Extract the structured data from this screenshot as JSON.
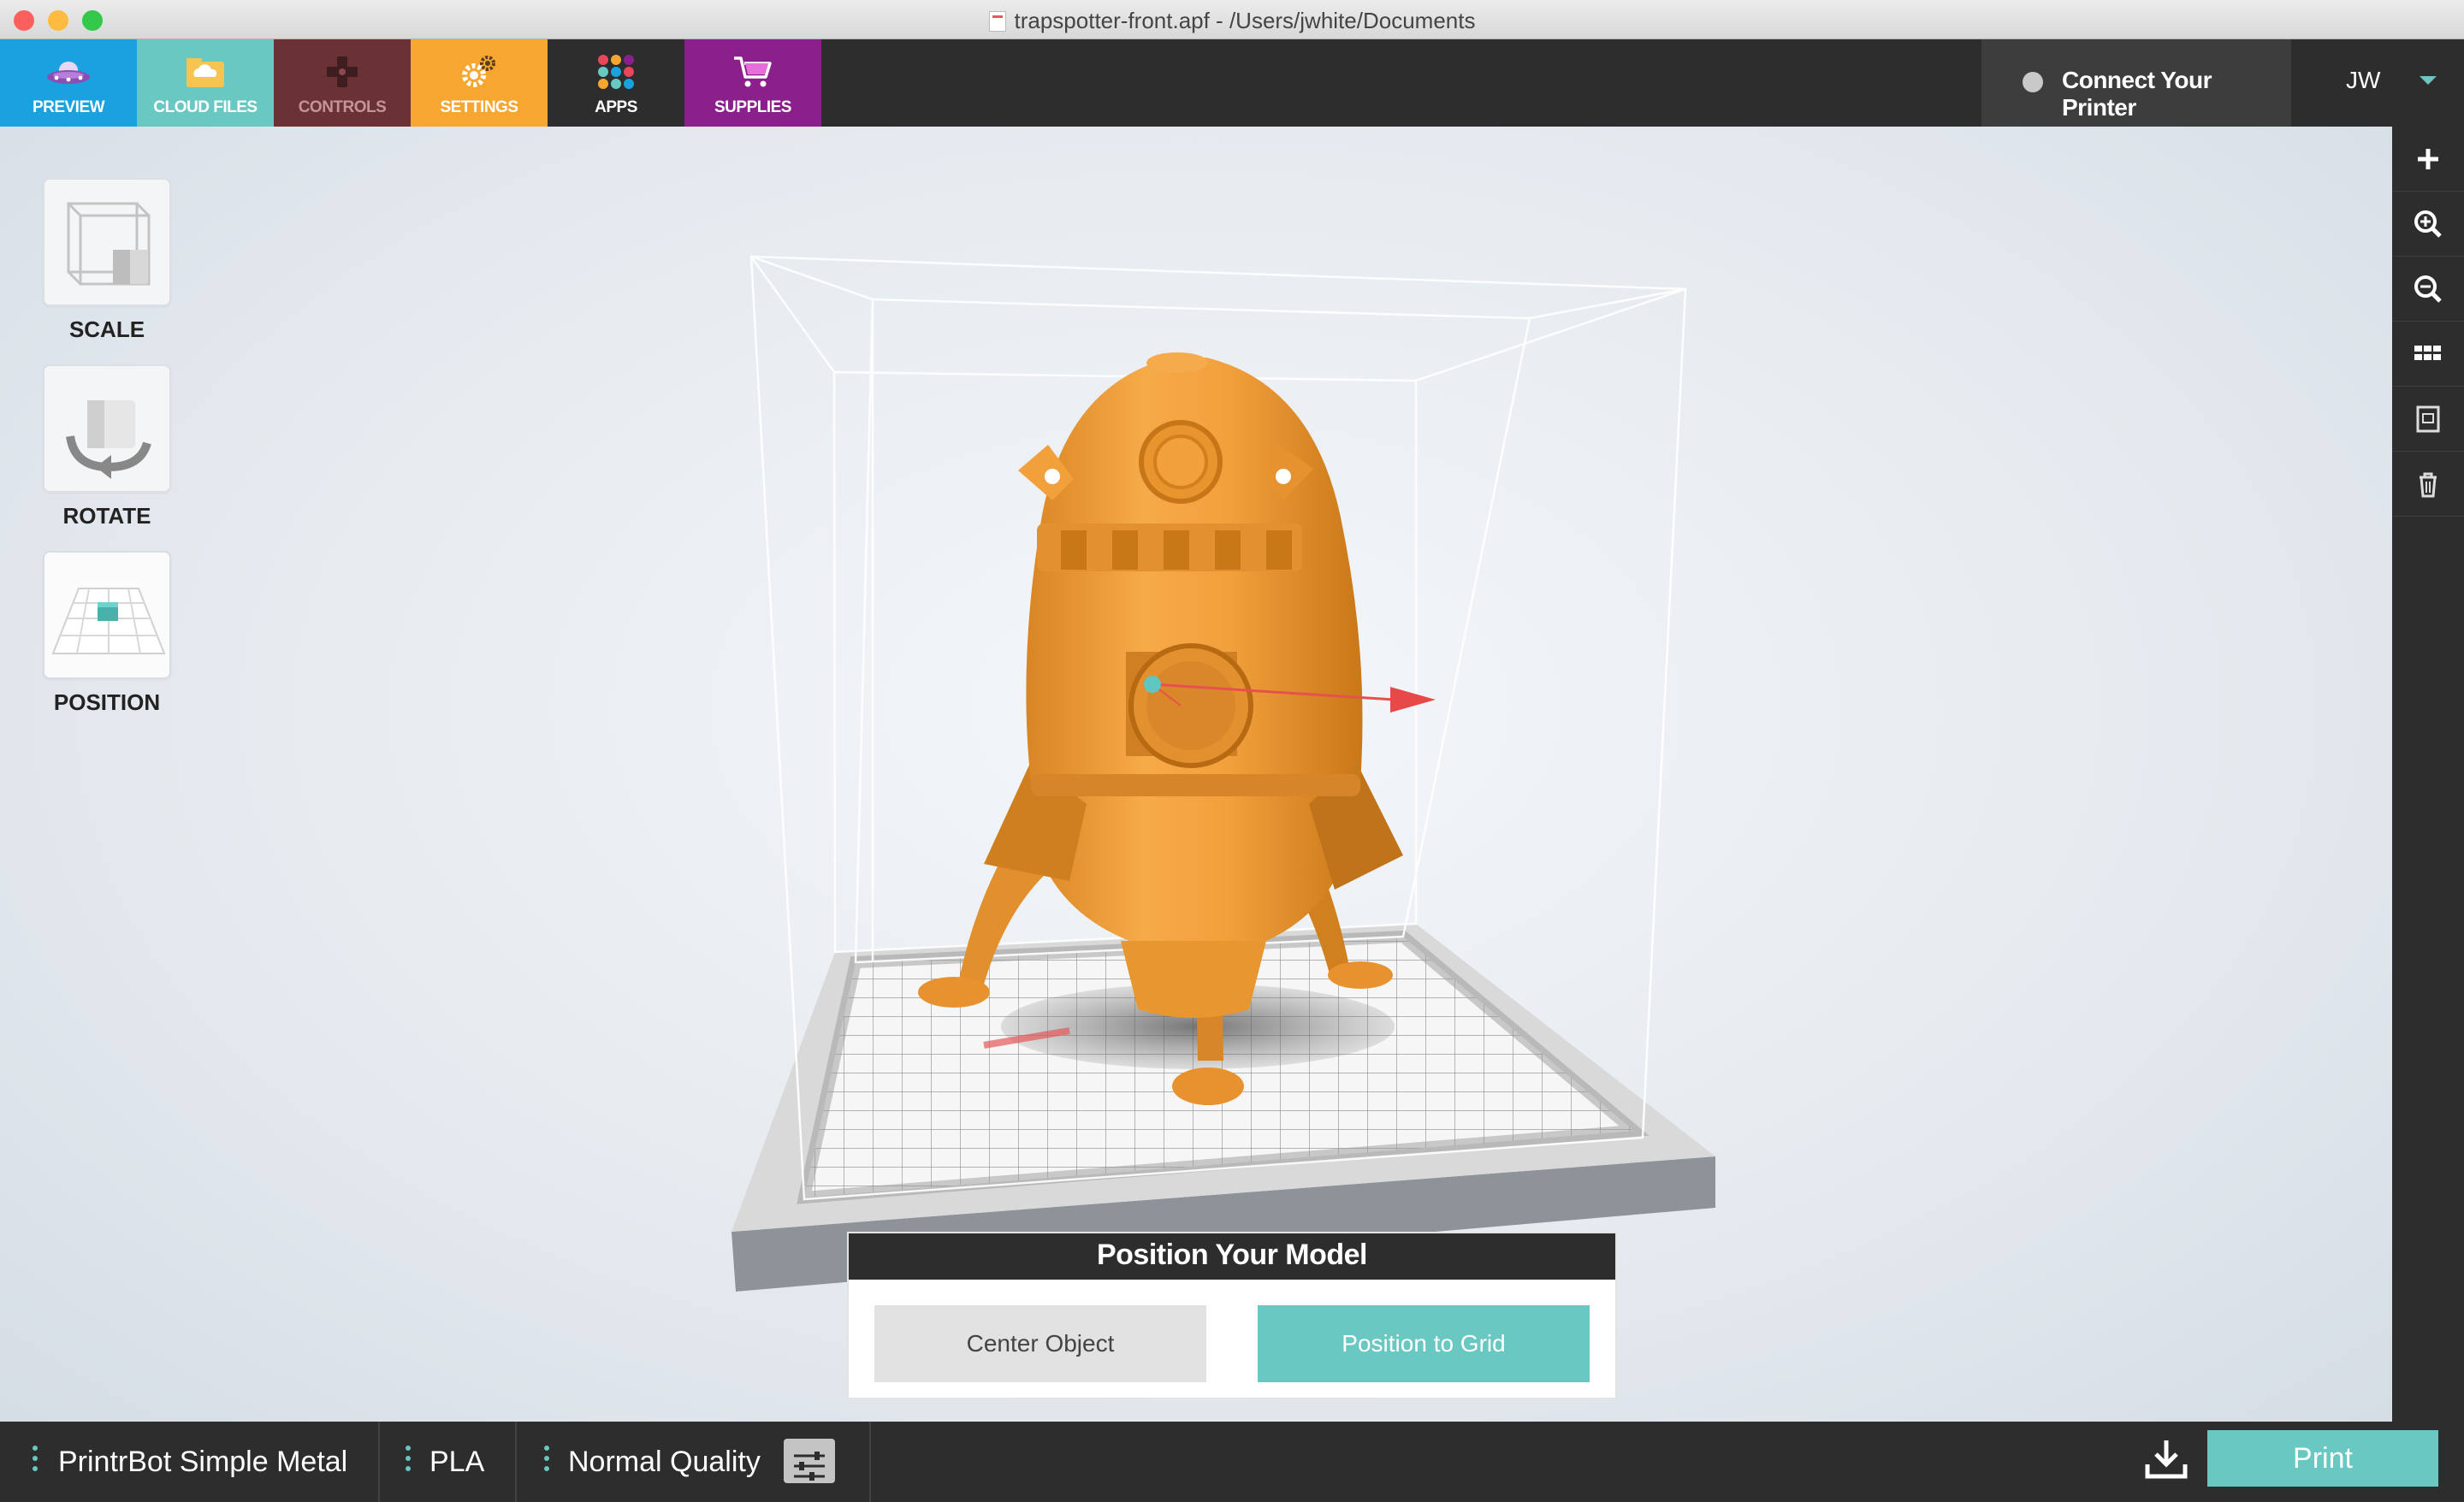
{
  "window": {
    "title": "trapspotter-front.apf - /Users/jwhite/Documents"
  },
  "nav": {
    "tabs": [
      {
        "label": "PREVIEW",
        "color": "#1aa1e0",
        "icon": "ufo-icon"
      },
      {
        "label": "CLOUD FILES",
        "color": "#6ac8c3",
        "icon": "cloud-folder-icon"
      },
      {
        "label": "CONTROLS",
        "color": "#6b3236",
        "icon": "dpad-icon"
      },
      {
        "label": "SETTINGS",
        "color": "#f7a630",
        "icon": "gears-icon"
      },
      {
        "label": "APPS",
        "color": "#2d2d2d",
        "icon": "apps-grid-icon"
      },
      {
        "label": "SUPPLIES",
        "color": "#8b1f8c",
        "icon": "cart-icon"
      }
    ],
    "connect_label": "Connect Your Printer",
    "user_initials": "JW"
  },
  "tools": [
    {
      "label": "SCALE",
      "icon": "scale-box-icon"
    },
    {
      "label": "ROTATE",
      "icon": "rotate-cube-icon"
    },
    {
      "label": "POSITION",
      "icon": "position-grid-icon"
    }
  ],
  "right_toolbar": [
    "add-icon",
    "zoom-in-icon",
    "zoom-out-icon",
    "grid-view-icon",
    "duplicate-icon",
    "trash-icon"
  ],
  "panel": {
    "title": "Position Your Model",
    "center_button": "Center Object",
    "grid_button": "Position to Grid"
  },
  "bottom": {
    "printer": "PrintrBot Simple Metal",
    "material": "PLA",
    "quality": "Normal Quality",
    "print_label": "Print"
  },
  "colors": {
    "accent": "#6ac8c3",
    "model": "#f2a03c",
    "dark": "#2d2d2d"
  }
}
